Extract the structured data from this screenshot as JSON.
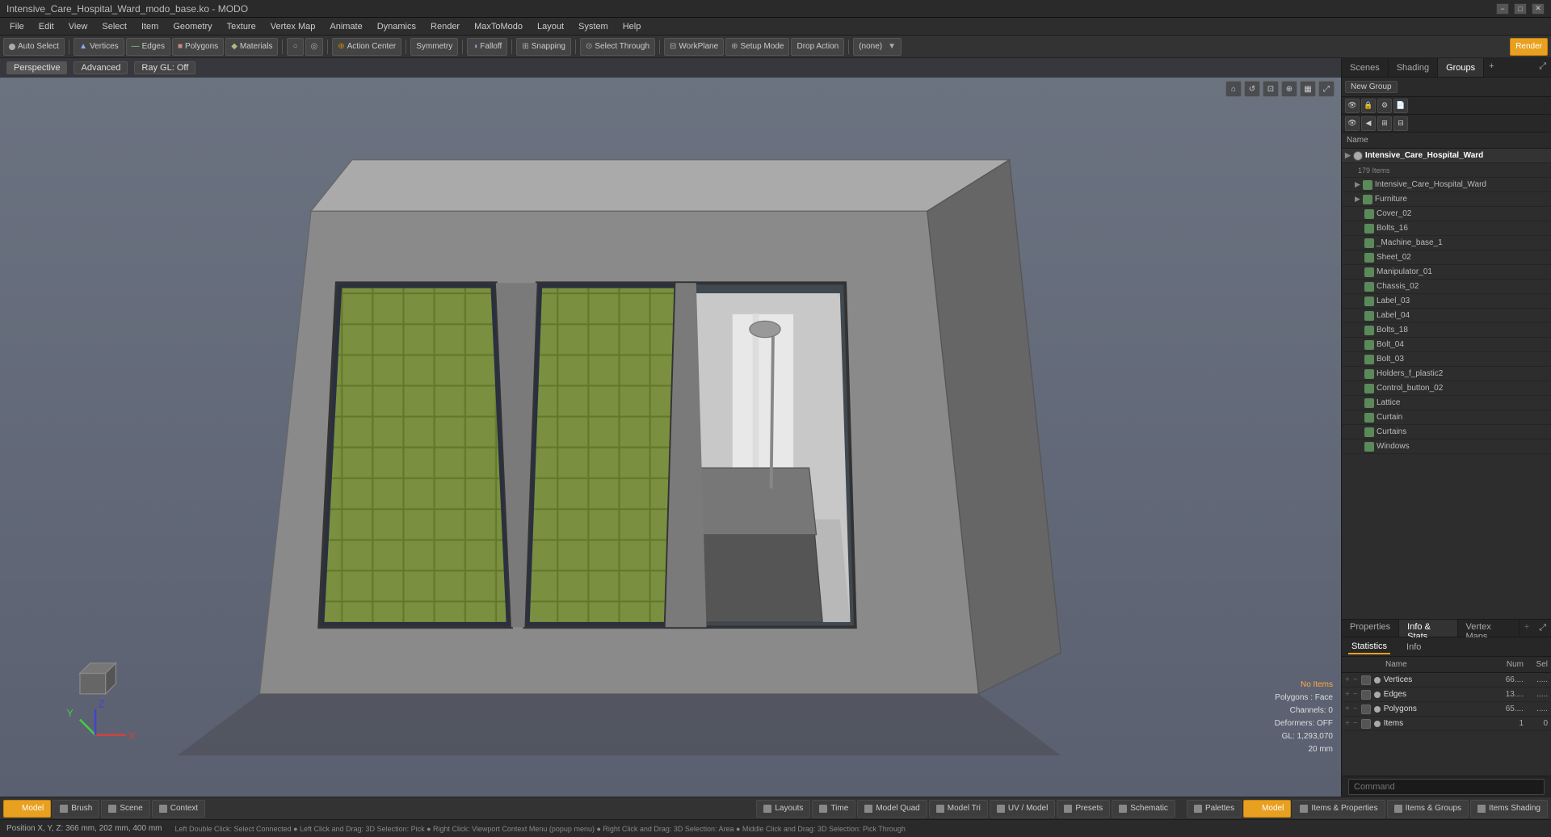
{
  "titlebar": {
    "title": "Intensive_Care_Hospital_Ward_modo_base.ko - MODO",
    "min": "−",
    "max": "□",
    "close": "✕"
  },
  "menubar": {
    "items": [
      "File",
      "Edit",
      "View",
      "Select",
      "Item",
      "Geometry",
      "Texture",
      "Vertex Map",
      "Animate",
      "Dynamics",
      "Render",
      "MaxToModo",
      "Layout",
      "System",
      "Help"
    ]
  },
  "toolbar": {
    "auto_select": "Auto Select",
    "vertices": "Vertices",
    "edges": "Edges",
    "polygons": "Polygons",
    "materials": "Materials",
    "action_center": "Action Center",
    "symmetry": "Symmetry",
    "falloff": "Falloff",
    "snapping": "Snapping",
    "select_through": "Select Through",
    "workplane": "WorkPlane",
    "setup_mode": "Setup Mode",
    "drop_action": "Drop Action",
    "none_dropdown": "(none)",
    "render": "Render"
  },
  "viewport": {
    "perspective": "Perspective",
    "advanced": "Advanced",
    "ray_gl": "Ray GL: Off",
    "stats": {
      "no_items": "No Items",
      "polygons_face": "Polygons : Face",
      "channels_0": "Channels: 0",
      "deformers_off": "Deformers: OFF",
      "gl_coords": "GL: 1,293,070",
      "units": "20 mm"
    }
  },
  "right_panel": {
    "tabs": [
      "Scenes",
      "Shading",
      "Groups"
    ],
    "active_tab": "Groups",
    "new_group_btn": "New Group",
    "column_header": "Name",
    "tree": {
      "root": {
        "name": "Intensive_Care_Hospital_Ward",
        "count": "179 Items",
        "children": [
          "Intensive_Care_Hospital_Ward",
          "Furniture",
          "Cover_02",
          "Bolts_16",
          "_Machine_base_1",
          "Sheet_02",
          "Manipulator_01",
          "Chassis_02",
          "Label_03",
          "Label_04",
          "Bolts_18",
          "Bolt_04",
          "Bolt_03",
          "Holders_f_plastic2",
          "Control_button_02",
          "Lattice",
          "Curtain",
          "Curtains",
          "Windows"
        ]
      }
    }
  },
  "properties_panel": {
    "tabs": [
      "Properties",
      "Info & Stats",
      "Vertex Maps"
    ],
    "active_tab": "Info & Stats",
    "add_btn": "+",
    "stats": {
      "active_tab": "Statistics",
      "info_tab": "Info",
      "col_name": "Name",
      "col_num": "Num",
      "col_sel": "Sel",
      "rows": [
        {
          "name": "Vertices",
          "num": "66....",
          "sel": "....."
        },
        {
          "name": "Edges",
          "num": "13....",
          "sel": "....."
        },
        {
          "name": "Polygons",
          "num": "65....",
          "sel": "....."
        },
        {
          "name": "Items",
          "num": "1",
          "sel": "0"
        }
      ]
    }
  },
  "command_bar": {
    "label": "Command",
    "placeholder": ""
  },
  "bottom_toolbar": {
    "left_items": [
      {
        "id": "model",
        "label": "Model",
        "active": true
      },
      {
        "id": "brush",
        "label": "Brush",
        "active": false
      },
      {
        "id": "scene",
        "label": "Scene",
        "active": false
      },
      {
        "id": "context",
        "label": "Context",
        "active": false
      }
    ],
    "center_items": [
      {
        "id": "layouts",
        "label": "Layouts"
      },
      {
        "id": "time",
        "label": "Time"
      },
      {
        "id": "model-quad",
        "label": "Model Quad"
      },
      {
        "id": "model-tri",
        "label": "Model Tri"
      },
      {
        "id": "uv-model",
        "label": "UV / Model"
      },
      {
        "id": "presets",
        "label": "Presets"
      },
      {
        "id": "schematic",
        "label": "Schematic"
      }
    ],
    "right_items": [
      {
        "id": "palettes",
        "label": "Palettes"
      },
      {
        "id": "model-view",
        "label": "Model",
        "active": true
      },
      {
        "id": "items-props",
        "label": "Items & Properties"
      },
      {
        "id": "items-groups",
        "label": "Items & Groups"
      },
      {
        "id": "items-shading",
        "label": "Items Shading"
      }
    ]
  },
  "statusbar": {
    "position": "Position X, Y, Z:  366 mm, 202 mm, 400 mm",
    "hint": "Left Double Click: Select Connected  ●  Left Click and Drag: 3D Selection: Pick  ●  Right Click: Viewport Context Menu (popup menu)  ●  Right Click and Drag: 3D Selection: Area  ●  Middle Click and Drag: 3D Selection: Pick Through"
  }
}
